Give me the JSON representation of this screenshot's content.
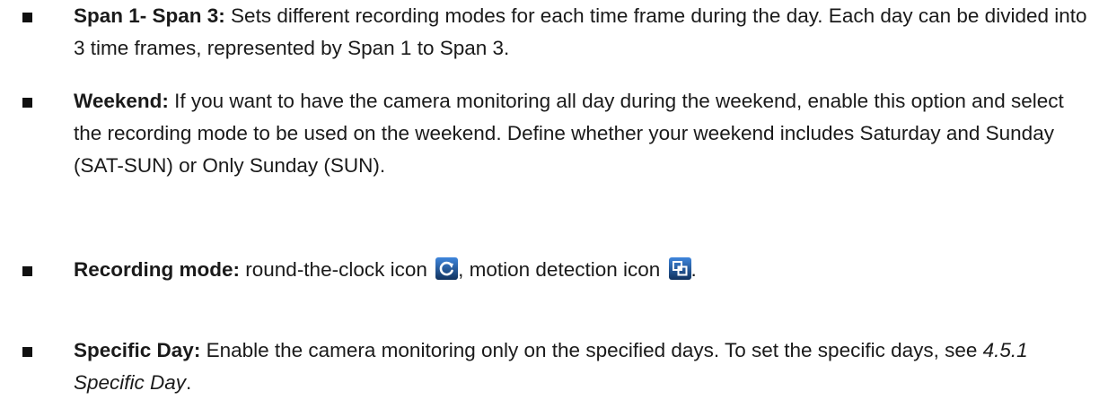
{
  "items": [
    {
      "term": "Span 1- Span 3:",
      "text": " Sets different recording modes for each time frame during the day. Each day can be divided into 3 time frames, represented by Span 1 to Span 3."
    },
    {
      "term": "Weekend:",
      "text": " If you want to have the camera monitoring all day during the weekend, enable this option and select the recording mode to be used on the weekend. Define whether your weekend includes Saturday and Sunday (SAT-SUN) or Only Sunday (SUN)."
    },
    {
      "term": "Recording mode:",
      "text_before_icon1": " round-the-clock icon ",
      "icon1": "round-the-clock-icon",
      "text_between": ", motion detection icon ",
      "icon2": "motion-detection-icon",
      "text_after": "."
    },
    {
      "term": "Specific Day:",
      "text": " Enable the camera monitoring only on the specified days. To set the specific days, see ",
      "ref": "4.5.1 Specific Day",
      "text_after": "."
    }
  ],
  "colors": {
    "text": "#1a1a1a",
    "icon_blue": "#2a6fc9",
    "icon_dark": "#10325e"
  }
}
